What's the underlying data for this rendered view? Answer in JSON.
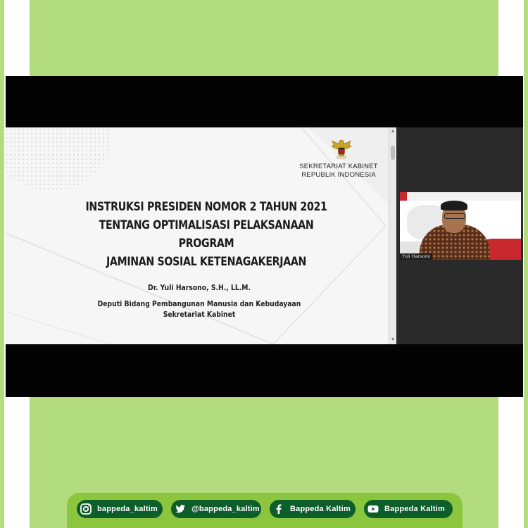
{
  "slide": {
    "org_line1": "SEKRETARIAT KABINET",
    "org_line2": "REPUBLIK INDONESIA",
    "title_line1": "INSTRUKSI PRESIDEN NOMOR 2 TAHUN 2021",
    "title_line2": "TENTANG OPTIMALISASI PELAKSANAAN PROGRAM",
    "title_line3": "JAMINAN SOSIAL KETENAGAKERJAAN",
    "presenter": "Dr. Yuli Harsono, S.H., LL.M.",
    "role_line1": "Deputi Bidang Pembangunan Manusia dan Kebudayaan",
    "role_line2": "Sekretariat Kabinet"
  },
  "participant": {
    "name_tag": "Yuli Harsono"
  },
  "social": {
    "instagram": "bappeda_kaltim",
    "twitter": "@bappeda_kaltim",
    "facebook": "Bappeda Kaltim",
    "youtube": "Bappeda Kaltim"
  },
  "colors": {
    "background_green": "#b3dc7e",
    "social_bar_green": "#8cc63f",
    "pill_dark_green": "#0d5e2a"
  }
}
